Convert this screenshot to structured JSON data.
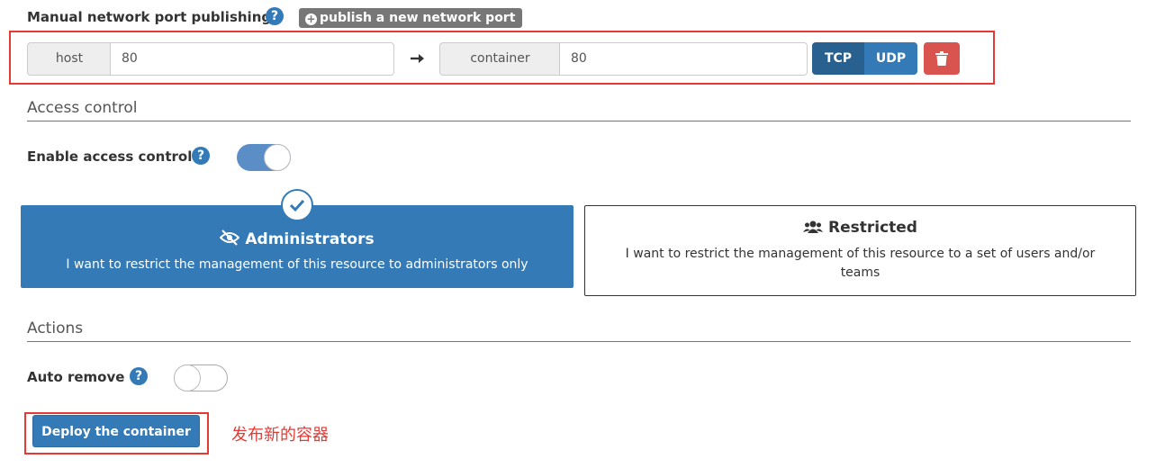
{
  "port_publishing": {
    "label": "Manual network port publishing",
    "publish_button": "publish a new network port",
    "mapping": {
      "host_label": "host",
      "host_value": "80",
      "container_label": "container",
      "container_value": "80",
      "protocols": [
        "TCP",
        "UDP"
      ],
      "selected_protocol": "TCP"
    }
  },
  "access_control": {
    "section_title": "Access control",
    "enable_label": "Enable access control",
    "enabled": true,
    "options": [
      {
        "title": "Administrators",
        "description": "I want to restrict the management of this resource to administrators only",
        "selected": true
      },
      {
        "title": "Restricted",
        "description_line1": "I want to restrict the management of this resource to a set of users and/or",
        "description_line2": "teams",
        "selected": false
      }
    ]
  },
  "actions": {
    "section_title": "Actions",
    "auto_remove_label": "Auto remove",
    "auto_remove": false,
    "deploy_button": "Deploy the container",
    "annotation": "发布新的容器"
  },
  "colors": {
    "primary": "#337ab7",
    "danger": "#d9534f",
    "annotation": "#e53935"
  }
}
